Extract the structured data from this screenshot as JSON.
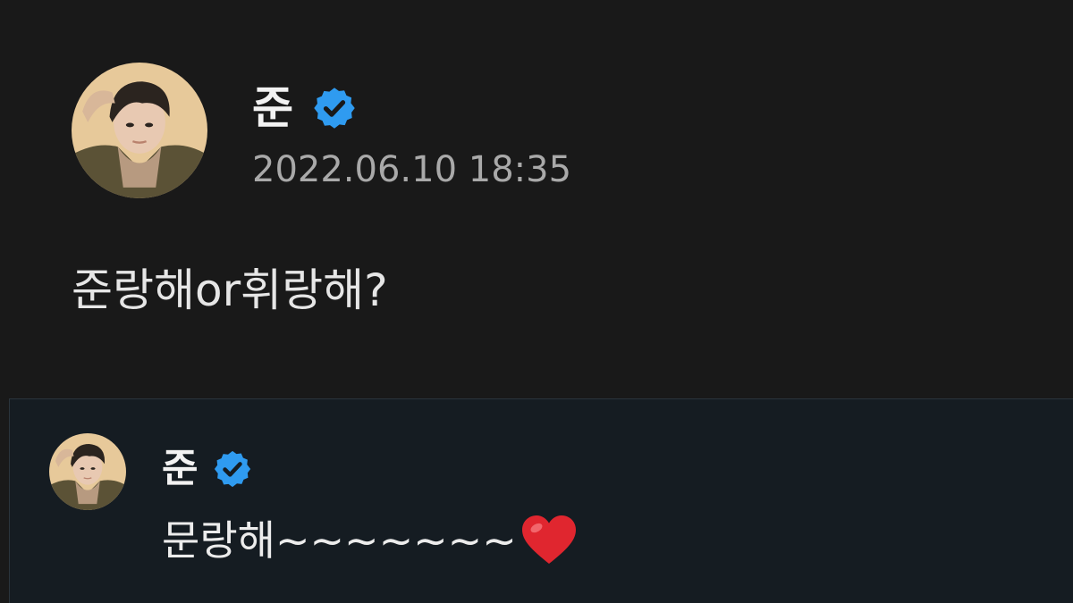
{
  "post": {
    "author": "준",
    "verified": true,
    "timestamp": "2022.06.10 18:35",
    "text": "준랑해or휘랑해?"
  },
  "reply": {
    "author": "준",
    "verified": true,
    "text": "문랑해~~~~~~~"
  },
  "icons": {
    "verified": "verified-badge-icon",
    "heart": "red-heart-icon"
  },
  "colors": {
    "background": "#191919",
    "reply_background": "#151c22",
    "badge_blue": "#2f9bf0",
    "heart_red": "#e0262f",
    "timestamp_gray": "#a9a9a9"
  }
}
